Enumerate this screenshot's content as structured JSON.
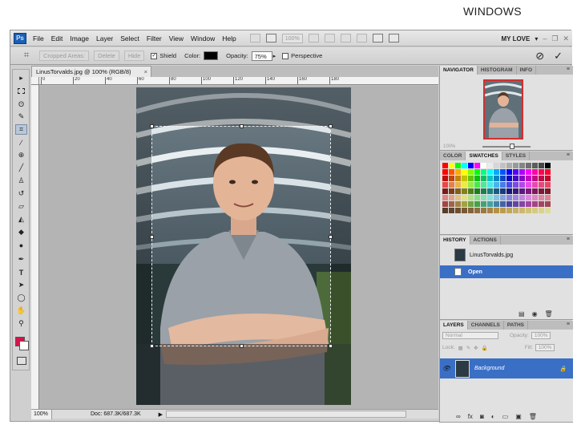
{
  "caption": "WINDOWS",
  "app": {
    "logo": "Ps",
    "menu": [
      "File",
      "Edit",
      "Image",
      "Layer",
      "Select",
      "Filter",
      "View",
      "Window",
      "Help"
    ],
    "zoom_dropdown": "100%",
    "workspace": "MY LOVE",
    "window_buttons": [
      "–",
      "❐",
      "✕"
    ]
  },
  "options": {
    "cropped_areas": "Cropped Areas:",
    "delete": "Delete",
    "hide": "Hide",
    "shield_label": "Shield",
    "shield_checked": true,
    "color_label": "Color:",
    "shield_color": "#000000",
    "opacity_label": "Opacity:",
    "opacity_value": "75%",
    "perspective_label": "Perspective",
    "perspective_checked": false,
    "cancel_symbol": "⊘",
    "commit_symbol": "✓"
  },
  "document": {
    "tab_title": "LinusTorvalds.jpg @ 100% (RGB/8)",
    "close": "×",
    "ruler_h": [
      "0",
      "20",
      "40",
      "60",
      "80",
      "100",
      "120",
      "140",
      "160",
      "180"
    ],
    "status_zoom": "100%",
    "status_doc": "Doc: 687.3K/687.3K",
    "status_arrow": "▶"
  },
  "toolbox": {
    "foreground_color": "#d6134a",
    "background_color": "#ffffff",
    "tools": [
      "move-icon",
      "marquee-icon",
      "lasso-icon",
      "quick-select-icon",
      "crop-icon",
      "eyedropper-icon",
      "healing-icon",
      "brush-icon",
      "clone-stamp-icon",
      "history-brush-icon",
      "eraser-icon",
      "gradient-icon",
      "blur-icon",
      "dodge-icon",
      "pen-icon",
      "type-icon",
      "path-select-icon",
      "shape-icon",
      "hand-icon",
      "zoom-icon"
    ],
    "type_glyph": "T"
  },
  "panels": {
    "navigator_tabs": [
      "NAVIGATOR",
      "HISTOGRAM",
      "INFO"
    ],
    "navigator_zoom": "100%",
    "swatches_tabs": [
      "COLOR",
      "SWATCHES",
      "STYLES"
    ],
    "history_tabs": [
      "HISTORY",
      "ACTIONS"
    ],
    "history_items": [
      {
        "label": "LinusTorvalds.jpg",
        "selected": false
      },
      {
        "label": "Open",
        "selected": true
      }
    ],
    "layers_tabs": [
      "LAYERS",
      "CHANNELS",
      "PATHS"
    ],
    "blend_mode": "Normal",
    "opacity_label": "Opacity:",
    "opacity_value": "100%",
    "lock_label": "Lock:",
    "fill_label": "Fill:",
    "fill_value": "100%",
    "layer_name": "Background"
  }
}
